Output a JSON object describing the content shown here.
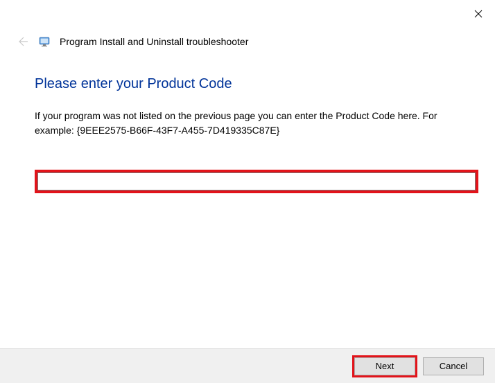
{
  "window": {
    "title": "Program Install and Uninstall troubleshooter"
  },
  "content": {
    "heading": "Please enter your Product Code",
    "description": "If your program was not listed on the previous page you can enter the Product Code here. For example: {9EEE2575-B66F-43F7-A455-7D419335C87E}",
    "input_value": ""
  },
  "buttons": {
    "next": "Next",
    "cancel": "Cancel"
  }
}
